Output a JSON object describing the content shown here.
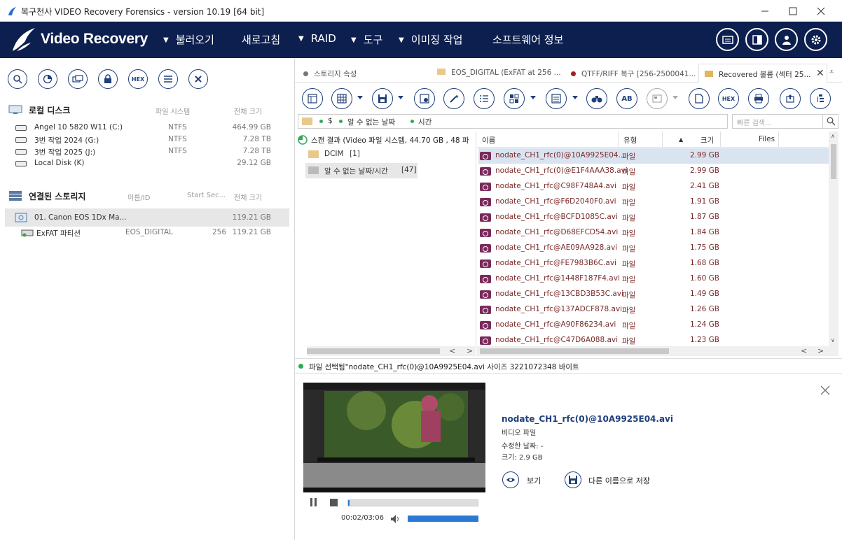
{
  "window": {
    "title": "복구천사 VIDEO Recovery Forensics - version 10.19 [64 bit]"
  },
  "menubar": {
    "brand": "Video Recovery",
    "items": [
      "불러오기",
      "새로고침",
      "RAID",
      "도구",
      "이미징 작업",
      "소프트웨어 정보"
    ]
  },
  "left_toolbar": {
    "hex_label": "HEX"
  },
  "local_disks": {
    "title": "로컬 디스크",
    "col_fs": "파일 시스템",
    "col_size": "전체 크기",
    "items": [
      {
        "name": "Angel 10 5820 W11 (C:)",
        "fs": "NTFS",
        "size": "464.99 GB"
      },
      {
        "name": "3번 작업 2024 (G:)",
        "fs": "NTFS",
        "size": "7.28 TB"
      },
      {
        "name": "3번 작업 2025 (J:)",
        "fs": "NTFS",
        "size": "7.28 TB"
      },
      {
        "name": "Local Disk (K)",
        "fs": "",
        "size": "29.12 GB"
      }
    ]
  },
  "connected_storage": {
    "title": "연결된 스토리지",
    "col_name": "이름/ID",
    "col_start": "Start Sec...",
    "col_size": "전체 크기",
    "device": {
      "name": "01. Canon EOS 1Dx Ma...",
      "size": "119.21 GB"
    },
    "partition": {
      "name": "ExFAT 파티션",
      "id": "EOS_DIGITAL",
      "start": "256",
      "size": "119.21 GB"
    }
  },
  "tabs": [
    {
      "label": "스토리지 속성"
    },
    {
      "label": "EOS_DIGITAL (ExFAT at 256 ..."
    },
    {
      "label": "QTFF/RIFF 복구 [256-2500041..."
    },
    {
      "label": "Recovered 볼륨 (섹터 25..."
    }
  ],
  "toolbar": {
    "hex_label": "HEX",
    "ab_label": "AB"
  },
  "path": {
    "seg1": "$",
    "seg2": "알 수 없는 날짜",
    "seg3": "시간"
  },
  "search": {
    "placeholder": "빠른 검색..."
  },
  "tree": {
    "root": "스캔 결과 (Video 파일 시스템, 44.70 GB , 48 파",
    "items": [
      {
        "label": "DCIM",
        "count": "[1]"
      },
      {
        "label": "알 수 없는 날짜/시간",
        "count": "[47]"
      }
    ]
  },
  "filelist": {
    "col_name": "이름",
    "col_type": "유형",
    "col_size": "크기",
    "col_files": "Files",
    "rows": [
      {
        "name": "nodate_CH1_rfc(0)@10A9925E04...",
        "type": "파일",
        "size": "2.99 GB"
      },
      {
        "name": "nodate_CH1_rfc(0)@E1F4AAA38.avi",
        "type": "파일",
        "size": "2.99 GB"
      },
      {
        "name": "nodate_CH1_rfc@C98F748A4.avi",
        "type": "파일",
        "size": "2.41 GB"
      },
      {
        "name": "nodate_CH1_rfc@F6D2040F0.avi",
        "type": "파일",
        "size": "1.91 GB"
      },
      {
        "name": "nodate_CH1_rfc@BCFD1085C.avi",
        "type": "파일",
        "size": "1.87 GB"
      },
      {
        "name": "nodate_CH1_rfc@D68EFCD54.avi",
        "type": "파일",
        "size": "1.84 GB"
      },
      {
        "name": "nodate_CH1_rfc@AE09AA928.avi",
        "type": "파일",
        "size": "1.75 GB"
      },
      {
        "name": "nodate_CH1_rfc@FE7983B6C.avi",
        "type": "파일",
        "size": "1.68 GB"
      },
      {
        "name": "nodate_CH1_rfc@1448F187F4.avi",
        "type": "파일",
        "size": "1.60 GB"
      },
      {
        "name": "nodate_CH1_rfc@13CBD3B53C.avi",
        "type": "파일",
        "size": "1.49 GB"
      },
      {
        "name": "nodate_CH1_rfc@137ADCF878.avi",
        "type": "파일",
        "size": "1.26 GB"
      },
      {
        "name": "nodate_CH1_rfc@A90F86234.avi",
        "type": "파일",
        "size": "1.24 GB"
      },
      {
        "name": "nodate_CH1_rfc@C47D6A088.avi",
        "type": "파일",
        "size": "1.23 GB"
      }
    ]
  },
  "status": {
    "text": "파일 선택됨\"nodate_CH1_rfc(0)@10A9925E04.avi 사이즈 3221072348 바이트"
  },
  "preview": {
    "filename": "nodate_CH1_rfc(0)@10A9925E04.avi",
    "kind": "비디오 파일",
    "modified": "수정한 날짜: -",
    "size": "크기: 2.9 GB",
    "view_label": "보기",
    "saveas_label": "다른 이름으로 저장",
    "time": "00:02/03:06",
    "progress_fraction": 0.011,
    "volume_fraction": 1.0
  },
  "colors": {
    "brand_bg": "#0d1f4f",
    "icon_blue": "#1f3f7a",
    "file_text": "#7a2a2a",
    "selection": "#d9e4f0",
    "progress": "#2a7ad5"
  }
}
